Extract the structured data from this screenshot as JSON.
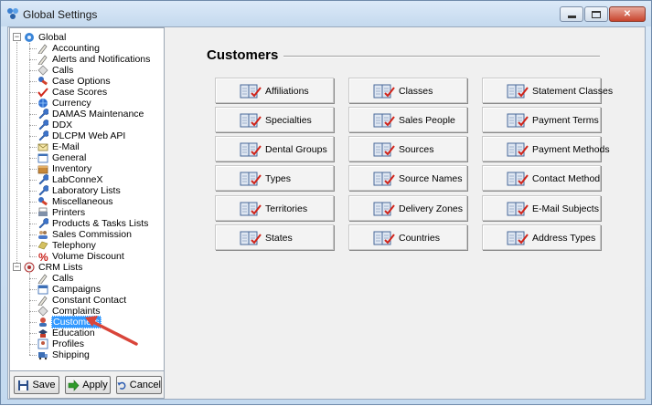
{
  "window": {
    "title": "Global Settings",
    "minimize_glyph": "",
    "maximize_glyph": "",
    "close_glyph": "✕"
  },
  "tree": {
    "global_label": "Global",
    "global_items": [
      {
        "label": "Accounting",
        "icon": "pencil-icon"
      },
      {
        "label": "Alerts and Notifications",
        "icon": "pencil-icon"
      },
      {
        "label": "Calls",
        "icon": "diamond-icon"
      },
      {
        "label": "Case Options",
        "icon": "tools-icon"
      },
      {
        "label": "Case Scores",
        "icon": "check-icon"
      },
      {
        "label": "Currency",
        "icon": "globe-icon"
      },
      {
        "label": "DAMAS Maintenance",
        "icon": "wrench-icon"
      },
      {
        "label": "DDX",
        "icon": "wrench-icon"
      },
      {
        "label": "DLCPM Web API",
        "icon": "wrench-icon"
      },
      {
        "label": "E-Mail",
        "icon": "email-icon"
      },
      {
        "label": "General",
        "icon": "window-icon"
      },
      {
        "label": "Inventory",
        "icon": "box-icon"
      },
      {
        "label": "LabConneX",
        "icon": "wrench-icon"
      },
      {
        "label": "Laboratory Lists",
        "icon": "wrench-icon"
      },
      {
        "label": "Miscellaneous",
        "icon": "tools-icon"
      },
      {
        "label": "Printers",
        "icon": "printer-icon"
      },
      {
        "label": "Products & Tasks Lists",
        "icon": "wrench-icon"
      },
      {
        "label": "Sales Commission",
        "icon": "people-icon"
      },
      {
        "label": "Telephony",
        "icon": "phone-icon"
      },
      {
        "label": "Volume Discount",
        "icon": "percent-icon"
      }
    ],
    "crm_label": "CRM Lists",
    "crm_items": [
      {
        "label": "Calls",
        "icon": "pencil-icon"
      },
      {
        "label": "Campaigns",
        "icon": "calendar-icon"
      },
      {
        "label": "Constant Contact",
        "icon": "pencil-icon"
      },
      {
        "label": "Complaints",
        "icon": "diamond-icon"
      },
      {
        "label": "Customers",
        "icon": "customers-icon",
        "selected": true
      },
      {
        "label": "Education",
        "icon": "education-icon"
      },
      {
        "label": "Profiles",
        "icon": "profile-icon"
      },
      {
        "label": "Shipping",
        "icon": "shipping-icon"
      }
    ]
  },
  "buttons": {
    "save": "Save",
    "apply": "Apply",
    "cancel": "Cancel"
  },
  "main": {
    "section_title": "Customers",
    "tiles": [
      [
        "Affiliations",
        "Classes",
        "Statement Classes"
      ],
      [
        "Specialties",
        "Sales People",
        "Payment Terms"
      ],
      [
        "Dental Groups",
        "Sources",
        "Payment Methods"
      ],
      [
        "Types",
        "Source Names",
        "Contact Method"
      ],
      [
        "Territories",
        "Delivery Zones",
        "E-Mail Subjects"
      ],
      [
        "States",
        "Countries",
        "Address Types"
      ]
    ]
  },
  "colors": {
    "selection": "#3399ff",
    "arrow": "#e0443a",
    "titlebar": "#c4d9ee"
  }
}
